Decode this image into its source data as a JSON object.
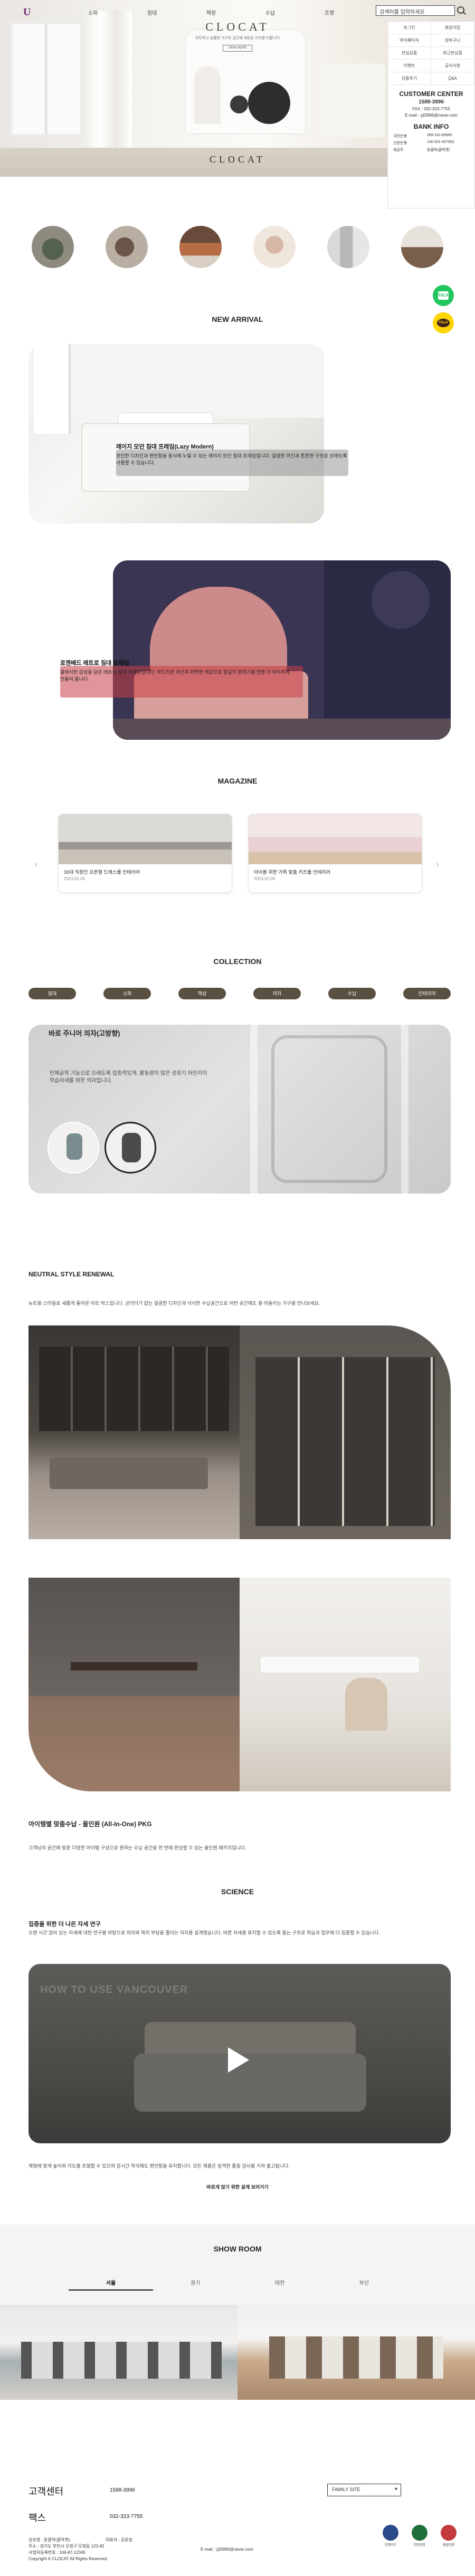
{
  "header": {
    "nav": [
      "소파",
      "침대",
      "책장",
      "수납",
      "조명"
    ],
    "search_placeholder": "검색어를 입력하세요",
    "brand_title": "CLOCAT",
    "brand_sub": "모던하고 심플한 가구로 공간에 새로운 가치를 더합니다",
    "brand_button": "VIEW MORE",
    "hero_bottom": "CLOCAT"
  },
  "side_panel": {
    "menu": [
      "로그인",
      "회원가입",
      "마이페이지",
      "장바구니",
      "관심상품",
      "최근본상품",
      "이벤트",
      "공지사항",
      "상품후기",
      "Q&A"
    ],
    "customer_title": "CUSTOMER CENTER",
    "phone": "1588-3996",
    "fax": "FAX : 032-323-7755",
    "email": "E-mail : yjl3996@naver.com",
    "bank_title": "BANK INFO",
    "banks": [
      {
        "name": "국민은행",
        "num": "289-102-83965"
      },
      {
        "name": "신한은행",
        "num": "140-001-457563"
      },
      {
        "name": "예금주",
        "num": "윤클락(클락캣)"
      }
    ]
  },
  "floating": {
    "talk_label": "TALK",
    "kakao_label": "TALK"
  },
  "new_arrival": {
    "section_title": "NEW ARRIVAL",
    "items": [
      {
        "title": "레이지 모던 침대 프레임(Lazy Modern)",
        "desc": "모던한 디자인과 편안함을 동시에 누릴 수 있는 레이지 모던 침대 프레임입니다. 깔끔한 라인과 튼튼한 구조로 오래도록 사용할 수 있습니다."
      },
      {
        "title": "로젠베드 레트로 침대 프레임",
        "desc": "클래식한 감성을 담은 레트로 침대 프레임입니다. 부드러운 곡선과 따뜻한 색감으로 침실의 분위기를 한층 더 아늑하게 만들어 줍니다."
      }
    ]
  },
  "magazine": {
    "section_title": "MAGAZINE",
    "items": [
      {
        "title": "30대 직장인 오픈형 드레스룸 인테리어",
        "date": "2023.02.09"
      },
      {
        "title": "아이를 위한 가족 맞춤 키즈룸 인테리어",
        "date": "2023.02.09"
      }
    ],
    "prev": "‹",
    "next": "›"
  },
  "collection": {
    "section_title": "COLLECTION",
    "tabs": [
      "침대",
      "소파",
      "책상",
      "의자",
      "수납",
      "인테리어"
    ],
    "panel_title": "바로 주니어 의자(고방향)",
    "panel_desc": "인체공학 기능으로 오래도록 집중력있게, 활동량이 많은 성장기 어린이의 학습자세를 위한 의자입니다."
  },
  "neutral": {
    "title": "NEUTRAL STYLE RENEWAL",
    "desc": "뉴트럴 스타일로 새롭게 돌아온 아트 박스입니다. 군더더기 없는 깔끔한 디자인과 넉넉한 수납공간으로 어떤 공간에도 잘 어울리는 가구를 만나보세요."
  },
  "package": {
    "title": "아이템별 맞춤수납 - 올인원 (All-In-One) PKG",
    "desc": "고객님의 공간에 맞춘 다양한 아이템 구성으로 원하는 수납 공간을 한 번에 완성할 수 있는 올인원 패키지입니다."
  },
  "science": {
    "section_title": "SCIENCE",
    "subtitle": "집중을 위한 더 나은 자세 연구",
    "desc": "오랜 시간 앉아 있는 자세에 대한 연구를 바탕으로 허리와 목의 부담을 줄이는 의자를 설계했습니다. 바른 자세를 유지할 수 있도록 돕는 구조로 학습과 업무에 더 집중할 수 있습니다.",
    "video_label": "HOW TO USE VANCOUVER",
    "foot": "체형에 맞게 높이와 각도를 조절할 수 있으며 장시간 착석에도 편안함을 유지합니다. 모든 제품은 엄격한 품질 검사를 거쳐 출고됩니다.",
    "link": "바르게 앉기 위한 설계 보러가기"
  },
  "showroom": {
    "section_title": "SHOW ROOM",
    "tabs": [
      "서울",
      "경기",
      "대전",
      "부산"
    ]
  },
  "footer": {
    "customer_label": "고객센터",
    "customer_phone": "1588-3996",
    "fax_label": "팩스",
    "fax_num": "032-323-7755",
    "company": "상호명 : 윤클락(클락캣)",
    "ceo": "대표자 : 김윤정",
    "address": "주소 : 경기도 부천시 오정구 오정동 123-45",
    "biz_num": "사업자등록번호 : 106-87-12345",
    "copyright": "Copyright © CLOCAT All Rights Reserved.",
    "email": "E-mail : yjl3996@naver.com",
    "family_site": "FAMILY SITE",
    "certs": [
      "인증마크",
      "안전인증",
      "품질인증"
    ]
  },
  "colors": {
    "accent_dark": "#5a5042",
    "talk_green": "#22c55e",
    "kakao_yellow": "#fcd400"
  }
}
